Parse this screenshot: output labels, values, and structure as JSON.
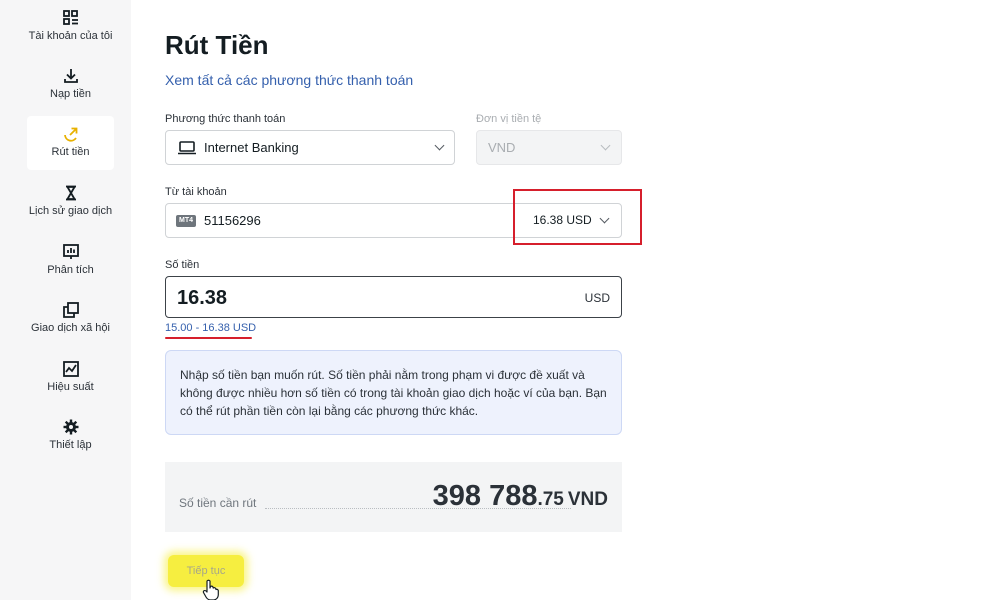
{
  "sidebar": {
    "items": [
      {
        "label": "Tài khoản của tôi",
        "icon": "account-grid-icon"
      },
      {
        "label": "Nạp tiền",
        "icon": "download-icon"
      },
      {
        "label": "Rút tiền",
        "icon": "withdraw-icon",
        "active": true
      },
      {
        "label": "Lịch sử giao dịch",
        "icon": "hourglass-icon"
      },
      {
        "label": "Phân tích",
        "icon": "chart-screen-icon"
      },
      {
        "label": "Giao dịch xã hội",
        "icon": "copy-icon"
      },
      {
        "label": "Hiệu suất",
        "icon": "performance-icon"
      },
      {
        "label": "Thiết lập",
        "icon": "gear-icon"
      }
    ]
  },
  "page": {
    "title": "Rút Tiền",
    "all_methods_link": "Xem tất cả các phương thức thanh toán"
  },
  "form": {
    "payment_method_label": "Phương thức thanh toán",
    "payment_method_value": "Internet Banking",
    "currency_unit_label": "Đơn vị tiền tệ",
    "currency_unit_value": "VND",
    "from_account_label": "Từ tài khoản",
    "account_badge": "MT4",
    "account_number": "51156296",
    "account_balance": "16.38 USD",
    "amount_label": "Số tiền",
    "amount_value": "16.38",
    "amount_currency": "USD",
    "amount_range": "15.00 - 16.38 USD"
  },
  "info": {
    "text": "Nhập số tiền bạn muốn rút. Số tiền phải nằm trong phạm vi được đề xuất và không được nhiều hơn số tiền có trong tài khoản giao dịch hoặc ví của bạn. Bạn có thể rút phần tiền còn lại bằng các phương thức khác."
  },
  "summary": {
    "label": "Số tiền cần rút",
    "amount_integer": "398 788",
    "amount_decimal": ".75",
    "currency": "VND"
  },
  "actions": {
    "continue_label": "Tiếp tục"
  },
  "colors": {
    "accent_link": "#3560ad",
    "highlight_red": "#d61f2c",
    "button_yellow": "#f6ee40",
    "info_bg": "#eef2fd"
  }
}
